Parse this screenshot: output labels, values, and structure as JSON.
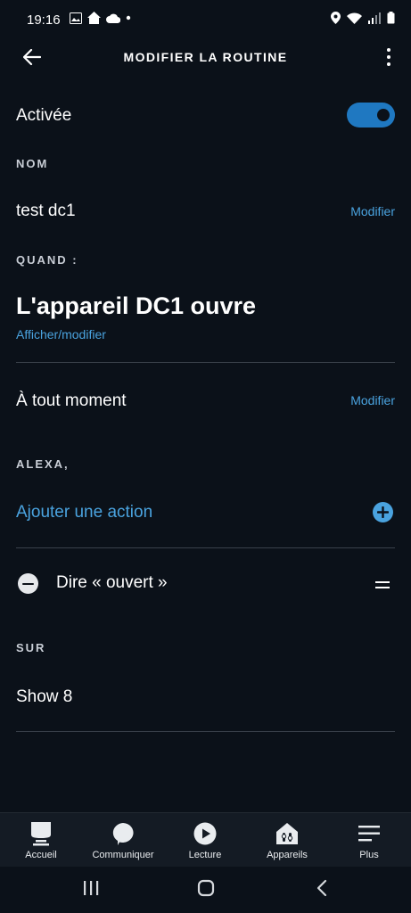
{
  "status_bar": {
    "time": "19:16"
  },
  "header": {
    "title": "MODIFIER LA ROUTINE"
  },
  "enabled": {
    "label": "Activée",
    "on": true
  },
  "name_section": {
    "label": "NOM",
    "value": "test dc1",
    "edit": "Modifier"
  },
  "when_section": {
    "label": "QUAND :",
    "trigger": "L'appareil DC1 ouvre",
    "view_edit": "Afficher/modifier",
    "time_text": "À tout moment",
    "time_edit": "Modifier"
  },
  "alexa_section": {
    "label": "ALEXA,",
    "add_action": "Ajouter une action",
    "actions": [
      {
        "label": "Dire « ouvert »"
      }
    ]
  },
  "on_section": {
    "label": "SUR",
    "device": "Show 8"
  },
  "bottom_nav": {
    "items": [
      {
        "label": "Accueil",
        "icon": "home-icon"
      },
      {
        "label": "Communiquer",
        "icon": "chat-icon"
      },
      {
        "label": "Lecture",
        "icon": "play-icon"
      },
      {
        "label": "Appareils",
        "icon": "devices-icon"
      },
      {
        "label": "Plus",
        "icon": "menu-icon"
      }
    ]
  },
  "colors": {
    "background": "#0b1119",
    "accent": "#4aa3df",
    "toggle": "#1f78c1"
  }
}
